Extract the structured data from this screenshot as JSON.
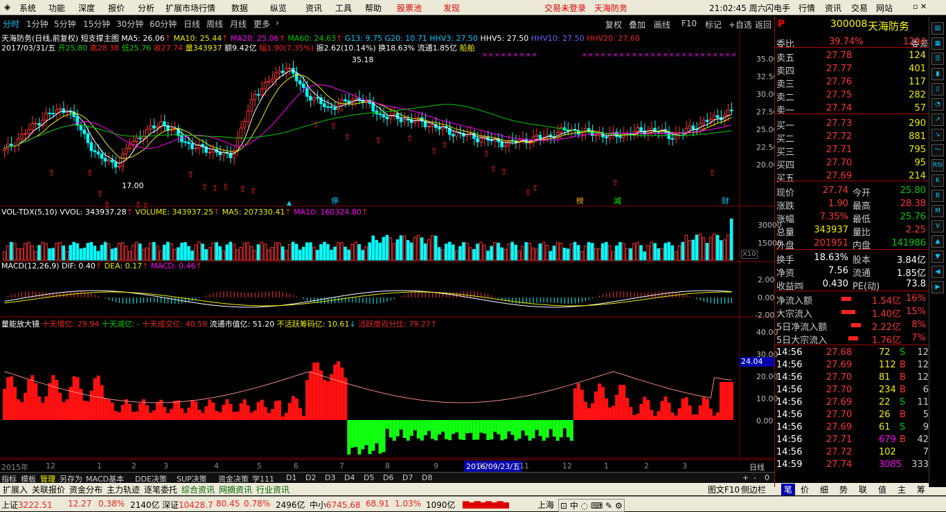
{
  "menu": {
    "items": [
      "系统",
      "功能",
      "深度",
      "报价",
      "分析",
      "扩展市场行情",
      "数据",
      "纵览",
      "资讯",
      "工具",
      "帮助"
    ],
    "stock_pool": "股票池",
    "discover": "发现",
    "login_status": "交易未登录",
    "broker": "天海防务",
    "clock": "21:02:45 周六",
    "flash": "闪电手",
    "right_tabs": [
      "行情",
      "资讯",
      "交易",
      "网站"
    ]
  },
  "period_tabs": [
    "分时",
    "1分钟",
    "5分钟",
    "15分钟",
    "30分钟",
    "60分钟",
    "日线",
    "周线",
    "月线",
    "更多"
  ],
  "right_buttons": [
    "复权",
    "叠加",
    "画线",
    "F10",
    "标记",
    "+自选",
    "返回"
  ],
  "main_header": {
    "line1": {
      "title": "天海防务(日线,前复权)",
      "indicator": "短支撑主图",
      "ma5": "MA5: 26.06",
      "ma10": "MA10: 25.44",
      "ma20": "MA20: 25.06",
      "ma60": "MA60: 24.63",
      "g13": "G13: 9.75",
      "g20": "G20: 10.71",
      "hhv3": "HHV3: 27.50",
      "hhv5": "HHV5: 27.50",
      "hhv10": "HHV10: 27.50",
      "hhv20": "HHV20: 27.60"
    },
    "line2": {
      "date": "2017/03/31/五",
      "open_l": "开",
      "open": "25.80",
      "high_l": "高",
      "high": "28.38",
      "low_l": "低",
      "low": "25.76",
      "close_l": "收",
      "close": "27.74",
      "vol_l": "量",
      "vol": "343937",
      "amt": "额9.42亿",
      "chg": "幅1.90(7.35%)",
      "amp": "振2.62(10.14%)",
      "turn": "换18.63%",
      "float": "流通1.85亿",
      "concept": "船舶"
    }
  },
  "price_axis": [
    "35.00",
    "32.50",
    "30.00",
    "27.50",
    "25.00",
    "22.50",
    "20.00"
  ],
  "price_marks": {
    "high": "35.18",
    "low": "17.00"
  },
  "event_markers": [
    {
      "label": "停",
      "color": "#0cf"
    },
    {
      "label": "榜",
      "color": "#fa0"
    },
    {
      "label": "减",
      "color": "#0f0"
    },
    {
      "label": "财",
      "color": "#0cf"
    }
  ],
  "vol_header": {
    "name": "VOL-TDX(5,10)",
    "vvol": "VVOL: 343937.28",
    "volume": "VOLUME: 343937.25",
    "ma5": "MA5: 207330.41",
    "ma10": "MA10: 160324.80"
  },
  "vol_axis": [
    "30000",
    "15000"
  ],
  "vol_unit": "X10",
  "macd_header": {
    "name": "MACD(12,26,9)",
    "dif": "DIF: 0.40",
    "dea": "DEA: 0.17",
    "macd": "MACD: 0.46"
  },
  "macd_axis": [
    "2.00",
    "0.00",
    "-2.00"
  ],
  "amp_header": {
    "name": "量能放大镜",
    "a": "十天增亿: 29.94",
    "b": "十天减亿: -",
    "c": "十天成交亿: 40.59",
    "d": "流通市值亿: 51.20",
    "e": "不活跃筹码亿: 10.61",
    "f": "活跃度百分比: 79.27"
  },
  "amp_axis": [
    "40.00",
    "30.00",
    "20.00",
    "10.00",
    "0.00"
  ],
  "amp_current": "24.04",
  "time_axis": {
    "year": "2015年",
    "months": [
      "12",
      "1",
      "2",
      "3",
      "4",
      "5",
      "6",
      "7",
      "8",
      "9",
      "10",
      "11",
      "12",
      "1",
      "2",
      "3"
    ],
    "cursor": "2016/09/23/五",
    "period": "日线"
  },
  "bottom_tabs": [
    "指标",
    "模板",
    "管理",
    "另存为",
    "MACD基本",
    "DDE决策",
    "SUP决策",
    "资金决策",
    "学111",
    "D1",
    "D2",
    "D3",
    "D4",
    "D5",
    "D6",
    "D7",
    "D8"
  ],
  "bottom_ctrl": [
    "+",
    "-",
    "0"
  ],
  "toolbar2": [
    "扩展入",
    "关联报价",
    "资金分布",
    "主力轨迹",
    "逐笔委托",
    "综合资讯",
    "网摘资讯",
    "行业资讯"
  ],
  "toolbar2_right": [
    "图文F10",
    "侧边栏"
  ],
  "right_bottom_tabs": [
    "笔",
    "价",
    "细",
    "势",
    "联",
    "值",
    "主",
    "筹"
  ],
  "quote": {
    "code": "300008",
    "name": "天海防务",
    "p_label": "P",
    "weibi_l": "委比",
    "weibi": "39.74%",
    "weicha_l": "委差",
    "weicha": "1294",
    "sells": [
      {
        "l": "卖五",
        "p": "27.78",
        "v": "124"
      },
      {
        "l": "卖四",
        "p": "27.77",
        "v": "401"
      },
      {
        "l": "卖三",
        "p": "27.76",
        "v": "117"
      },
      {
        "l": "卖二",
        "p": "27.75",
        "v": "282"
      },
      {
        "l": "卖一",
        "p": "27.74",
        "v": "57"
      }
    ],
    "buys": [
      {
        "l": "买一",
        "p": "27.73",
        "v": "290"
      },
      {
        "l": "买二",
        "p": "27.72",
        "v": "881"
      },
      {
        "l": "买三",
        "p": "27.71",
        "v": "795"
      },
      {
        "l": "买四",
        "p": "27.70",
        "v": "95"
      },
      {
        "l": "买五",
        "p": "27.69",
        "v": "214"
      }
    ],
    "stats": [
      {
        "l1": "现价",
        "v1": "27.74",
        "c1": "red",
        "l2": "今开",
        "v2": "25.80",
        "c2": "grn"
      },
      {
        "l1": "涨跌",
        "v1": "1.90",
        "c1": "red",
        "l2": "最高",
        "v2": "28.38",
        "c2": "red"
      },
      {
        "l1": "涨幅",
        "v1": "7.35%",
        "c1": "red",
        "l2": "最低",
        "v2": "25.76",
        "c2": "grn"
      },
      {
        "l1": "总量",
        "v1": "343937",
        "c1": "yel",
        "l2": "量比",
        "v2": "2.25",
        "c2": "red"
      },
      {
        "l1": "外盘",
        "v1": "201951",
        "c1": "red",
        "l2": "内盘",
        "v2": "141986",
        "c2": "grn"
      }
    ],
    "stats2": [
      {
        "l1": "换手",
        "v1": "18.63%",
        "l2": "股本",
        "v2": "3.84亿"
      },
      {
        "l1": "净资",
        "v1": "7.56",
        "l2": "流通",
        "v2": "1.85亿"
      },
      {
        "l1": "收益㈣",
        "v1": "0.430",
        "l2": "PE(动)",
        "v2": "73.8"
      }
    ],
    "flows": [
      {
        "l": "净流入额",
        "v": "1.54亿",
        "p": "16%"
      },
      {
        "l": "大宗流入",
        "v": "1.40亿",
        "p": "15%"
      },
      {
        "l": "5日净流入额",
        "v": "2.22亿",
        "p": "8%"
      },
      {
        "l": "5日大宗流入",
        "v": "1.76亿",
        "p": "7%"
      }
    ],
    "ticks": [
      {
        "t": "14:56",
        "p": "27.68",
        "v": "72",
        "s": "S",
        "n": "12"
      },
      {
        "t": "14:56",
        "p": "27.69",
        "v": "112",
        "s": "B",
        "n": "12"
      },
      {
        "t": "14:56",
        "p": "27.70",
        "v": "81",
        "s": "B",
        "n": "12"
      },
      {
        "t": "14:56",
        "p": "27.70",
        "v": "234",
        "s": "B",
        "n": "6"
      },
      {
        "t": "14:56",
        "p": "27.69",
        "v": "22",
        "s": "S",
        "n": "11"
      },
      {
        "t": "14:56",
        "p": "27.70",
        "v": "26",
        "s": "B",
        "n": "5"
      },
      {
        "t": "14:56",
        "p": "27.69",
        "v": "61",
        "s": "S",
        "n": "9"
      },
      {
        "t": "14:56",
        "p": "27.71",
        "v": "679",
        "s": "B",
        "n": "42"
      },
      {
        "t": "14:56",
        "p": "27.72",
        "v": "102",
        "s": "",
        "n": "7"
      },
      {
        "t": "14:59",
        "p": "27.74",
        "v": "3085",
        "s": "",
        "n": "333"
      }
    ]
  },
  "sidebar_icons": [
    "chart-icon",
    "grid-icon",
    "list-icon",
    "kline-icon",
    "bars-icon",
    "pie-icon",
    "up-icon",
    "down-icon",
    "ma-icon",
    "rsi-icon",
    "kdj-icon",
    "boll-icon",
    "macd-icon",
    "vol-icon",
    "arrow-up-icon",
    "arrow-down-icon",
    "arrow-left-icon",
    "arrow-right-icon"
  ],
  "statusbar": {
    "sh_l": "上证",
    "sh": "3222.51",
    "sh_c": "12.27",
    "sh_p": "0.38%",
    "sh_a": "2140亿",
    "sz_l": "深证",
    "sz": "10428.7",
    "sz_c": "80.45",
    "sz_p": "0.78%",
    "sz_a": "2496亿",
    "zx_l": "中小",
    "zx": "6745.68",
    "zx_c": "68.91",
    "zx_p": "1.03%",
    "zx_a": "1090亿",
    "city": "上海"
  }
}
